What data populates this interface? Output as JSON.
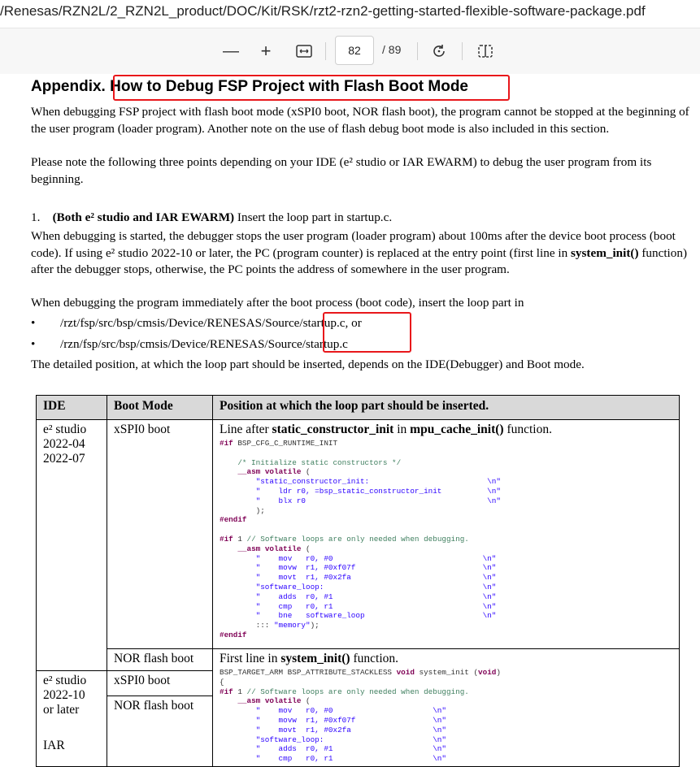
{
  "window": {
    "title": "/Renesas/RZN2L/2_RZN2L_product/DOC/Kit/RSK/rzt2-rzn2-getting-started-flexible-software-package.pdf"
  },
  "toolbar": {
    "zoom_out": "—",
    "zoom_in": "+",
    "fit": "↔",
    "page_current": "82",
    "page_total": "/ 89",
    "rotate": "↻",
    "two_page": "◫"
  },
  "doc": {
    "heading_prefix": "Appendix.",
    "heading_title": "How to Debug FSP Project with Flash Boot Mode",
    "p1": "When debugging FSP project with flash boot mode (xSPI0 boot, NOR flash boot), the program cannot be stopped at the beginning of the user program (loader program). Another note on the use of flash debug boot mode is also included in this section.",
    "p2": "Please note the following three points depending on your IDE (e² studio or IAR EWARM) to debug the user program from its beginning.",
    "item1_num": "1.",
    "item1_bold": "(Both e² studio and IAR EWARM)",
    "item1_rest": " Insert the loop part in startup.c.",
    "p3a": "When debugging is started, the debugger stops the user program (loader program) about 100ms after the device boot process (boot code). If using e² studio 2022-10 or later, the PC (program counter) is replaced at the entry point (first line in ",
    "p3_bold": "system_init()",
    "p3b": " function) after the debugger stops, otherwise, the PC points the address of somewhere in the user program.",
    "p4": "When debugging the program immediately after the boot process (boot code), insert the loop part in",
    "bullet_dot": "•",
    "bullet1": "/rzt/fsp/src/bsp/cmsis/Device/RENESAS/Source/startup.c, or",
    "bullet2": "/rzn/fsp/src/bsp/cmsis/Device/RENESAS/Source/startup.c",
    "p5": "The detailed position, at which the loop part should be inserted, depends on the IDE(Debugger) and Boot mode."
  },
  "table": {
    "headers": [
      "IDE",
      "Boot Mode",
      "Position at which the loop part should be inserted."
    ],
    "r1_ide": [
      "e² studio",
      "2022-04",
      "2022-07"
    ],
    "r1_mode": "xSPI0 boot",
    "r1_pos_a": "Line after ",
    "r1_pos_b": "static_constructor_init",
    "r1_pos_c": " in ",
    "r1_pos_d": "mpu_cache_init()",
    "r1_pos_e": " function.",
    "r2_mode": "NOR flash boot",
    "r2_pos_a": "First line in ",
    "r2_pos_b": "system_init()",
    "r2_pos_c": " function.",
    "r3_ide": [
      "e² studio",
      "2022-10",
      "or later"
    ],
    "r3_ide2": "IAR",
    "r3_mode1": "xSPI0 boot",
    "r3_mode2": "NOR flash boot"
  },
  "code": {
    "block1": [
      "#if BSP_CFG_C_RUNTIME_INIT",
      "",
      "    /* Initialize static constructors */",
      "    __asm volatile (",
      "        \"static_constructor_init:                          \\n\"",
      "        \"    ldr r0, =bsp_static_constructor_init          \\n\"",
      "        \"    blx r0                                        \\n\"",
      "        );",
      "#endif",
      "",
      "#if 1 // Software loops are only needed when debugging.",
      "    __asm volatile (",
      "        \"    mov   r0, #0                                 \\n\"",
      "        \"    movw  r1, #0xf07f                            \\n\"",
      "        \"    movt  r1, #0x2fa                             \\n\"",
      "        \"software_loop:                                   \\n\"",
      "        \"    adds  r0, #1                                 \\n\"",
      "        \"    cmp   r0, r1                                 \\n\"",
      "        \"    bne   software_loop                          \\n\"",
      "        ::: \"memory\");",
      "#endif"
    ],
    "block2": [
      "BSP_TARGET_ARM BSP_ATTRIBUTE_STACKLESS void system_init (void)",
      "{",
      "#if 1 // Software loops are only needed when debugging.",
      "    __asm volatile (",
      "        \"    mov   r0, #0                      \\n\"",
      "        \"    movw  r1, #0xf07f                 \\n\"",
      "        \"    movt  r1, #0x2fa                  \\n\"",
      "        \"software_loop:                        \\n\"",
      "        \"    adds  r0, #1                      \\n\"",
      "        \"    cmp   r0, r1                      \\n\""
    ]
  },
  "colors": {
    "highlight_box": "#e8171b",
    "header_bg": "#d9d9d9"
  }
}
